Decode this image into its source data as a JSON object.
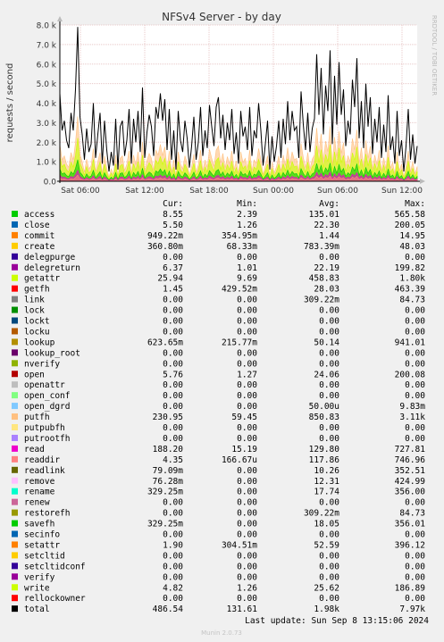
{
  "chart_data": {
    "type": "line",
    "title": "NFSv4 Server - by day",
    "ylabel": "requests / second",
    "side_label": "RRDTOOL / TOBI OETIKER",
    "ylim": [
      0,
      8000
    ],
    "yticks": [
      "0.0",
      "1.0 k",
      "2.0 k",
      "3.0 k",
      "4.0 k",
      "5.0 k",
      "6.0 k",
      "7.0 k",
      "8.0 k"
    ],
    "xticks": [
      "Sat 06:00",
      "Sat 12:00",
      "Sat 18:00",
      "Sun 00:00",
      "Sun 06:00",
      "Sun 12:00"
    ],
    "grid": true,
    "series": [
      {
        "name": "total",
        "color": "#000000",
        "values": [
          4500,
          2600,
          3100,
          2100,
          1700,
          3500,
          2600,
          4700,
          7900,
          3300,
          2400,
          1100,
          2700,
          1500,
          1900,
          4000,
          1200,
          2400,
          3500,
          900,
          3100,
          1600,
          500,
          1500,
          800,
          3200,
          600,
          2800,
          3100,
          1300,
          2100,
          3700,
          900,
          3200,
          2000,
          3600,
          1500,
          4800,
          1200,
          2500,
          3400,
          2800,
          1300,
          3800,
          3200,
          4500,
          3100,
          4200,
          1600,
          3700,
          1100,
          2600,
          600,
          3600,
          2100,
          1500,
          3100,
          2200,
          700,
          1800,
          3300,
          1100,
          2000,
          3800,
          1300,
          2600,
          1700,
          3900,
          2800,
          1800,
          3800,
          4300,
          2200,
          3400,
          1600,
          3000,
          2100,
          3700,
          1400,
          2500,
          900,
          3600,
          2300,
          2800,
          1600,
          3800,
          1300,
          2600,
          2200,
          4000,
          2600,
          800,
          1900,
          3100,
          600,
          2300,
          1000,
          1800,
          3100,
          1200,
          3200,
          1900,
          4100,
          2100,
          3600,
          2600,
          2800,
          1200,
          4600,
          2900,
          1600,
          3500,
          1500,
          2700,
          3200,
          6500,
          3400,
          5800,
          2400,
          4900,
          3600,
          6700,
          1900,
          5400,
          2900,
          6100,
          3400,
          4700,
          1800,
          3100,
          2400,
          5200,
          3800,
          6300,
          2200,
          4100,
          1700,
          5000,
          2800,
          4300,
          1400,
          3200,
          2000,
          3800,
          1200,
          2900,
          1500,
          4400,
          1600,
          2300,
          900,
          3600,
          1300,
          2100,
          500,
          1800,
          3700,
          1100,
          2400,
          900,
          1800
        ]
      }
    ]
  },
  "legend": {
    "headers": {
      "cur": "Cur:",
      "min": "Min:",
      "avg": "Avg:",
      "max": "Max:"
    },
    "rows": [
      {
        "name": "access",
        "color": "#00cc00",
        "cur": "8.55",
        "min": "2.39",
        "avg": "135.01",
        "max": "565.58"
      },
      {
        "name": "close",
        "color": "#0066b3",
        "cur": "5.50",
        "min": "1.26",
        "avg": "22.30",
        "max": "200.05"
      },
      {
        "name": "commit",
        "color": "#ff8000",
        "cur": "949.22m",
        "min": "354.95m",
        "avg": "1.44",
        "max": "14.95"
      },
      {
        "name": "create",
        "color": "#ffcc00",
        "cur": "360.80m",
        "min": "68.33m",
        "avg": "783.39m",
        "max": "48.03"
      },
      {
        "name": "delegpurge",
        "color": "#330099",
        "cur": "0.00",
        "min": "0.00",
        "avg": "0.00",
        "max": "0.00"
      },
      {
        "name": "delegreturn",
        "color": "#990099",
        "cur": "6.37",
        "min": "1.01",
        "avg": "22.19",
        "max": "199.82"
      },
      {
        "name": "getattr",
        "color": "#ccff00",
        "cur": "25.94",
        "min": "9.69",
        "avg": "458.83",
        "max": "1.80k"
      },
      {
        "name": "getfh",
        "color": "#ff0000",
        "cur": "1.45",
        "min": "429.52m",
        "avg": "28.03",
        "max": "463.39"
      },
      {
        "name": "link",
        "color": "#808080",
        "cur": "0.00",
        "min": "0.00",
        "avg": "309.22m",
        "max": "84.73"
      },
      {
        "name": "lock",
        "color": "#008f00",
        "cur": "0.00",
        "min": "0.00",
        "avg": "0.00",
        "max": "0.00"
      },
      {
        "name": "lockt",
        "color": "#00487d",
        "cur": "0.00",
        "min": "0.00",
        "avg": "0.00",
        "max": "0.00"
      },
      {
        "name": "locku",
        "color": "#b35a00",
        "cur": "0.00",
        "min": "0.00",
        "avg": "0.00",
        "max": "0.00"
      },
      {
        "name": "lookup",
        "color": "#b38f00",
        "cur": "623.65m",
        "min": "215.77m",
        "avg": "50.14",
        "max": "941.01"
      },
      {
        "name": "lookup_root",
        "color": "#6b006b",
        "cur": "0.00",
        "min": "0.00",
        "avg": "0.00",
        "max": "0.00"
      },
      {
        "name": "nverify",
        "color": "#8fb300",
        "cur": "0.00",
        "min": "0.00",
        "avg": "0.00",
        "max": "0.00"
      },
      {
        "name": "open",
        "color": "#b30000",
        "cur": "5.76",
        "min": "1.27",
        "avg": "24.06",
        "max": "200.08"
      },
      {
        "name": "openattr",
        "color": "#bebebe",
        "cur": "0.00",
        "min": "0.00",
        "avg": "0.00",
        "max": "0.00"
      },
      {
        "name": "open_conf",
        "color": "#80ff80",
        "cur": "0.00",
        "min": "0.00",
        "avg": "0.00",
        "max": "0.00"
      },
      {
        "name": "open_dgrd",
        "color": "#80c9ff",
        "cur": "0.00",
        "min": "0.00",
        "avg": "50.00u",
        "max": "9.83m"
      },
      {
        "name": "putfh",
        "color": "#ffc080",
        "cur": "230.95",
        "min": "59.45",
        "avg": "850.83",
        "max": "3.11k"
      },
      {
        "name": "putpubfh",
        "color": "#ffe680",
        "cur": "0.00",
        "min": "0.00",
        "avg": "0.00",
        "max": "0.00"
      },
      {
        "name": "putrootfh",
        "color": "#aa80ff",
        "cur": "0.00",
        "min": "0.00",
        "avg": "0.00",
        "max": "0.00"
      },
      {
        "name": "read",
        "color": "#ee00cc",
        "cur": "188.20",
        "min": "15.19",
        "avg": "129.80",
        "max": "727.81"
      },
      {
        "name": "readdir",
        "color": "#ff8080",
        "cur": "4.35",
        "min": "166.67u",
        "avg": "117.86",
        "max": "746.96"
      },
      {
        "name": "readlink",
        "color": "#666600",
        "cur": "79.09m",
        "min": "0.00",
        "avg": "10.26",
        "max": "352.51"
      },
      {
        "name": "remove",
        "color": "#ffbfff",
        "cur": "76.28m",
        "min": "0.00",
        "avg": "12.31",
        "max": "424.99"
      },
      {
        "name": "rename",
        "color": "#00ffcc",
        "cur": "329.25m",
        "min": "0.00",
        "avg": "17.74",
        "max": "356.00"
      },
      {
        "name": "renew",
        "color": "#cc6699",
        "cur": "0.00",
        "min": "0.00",
        "avg": "0.00",
        "max": "0.00"
      },
      {
        "name": "restorefh",
        "color": "#999900",
        "cur": "0.00",
        "min": "0.00",
        "avg": "309.22m",
        "max": "84.73"
      },
      {
        "name": "savefh",
        "color": "#00cc00",
        "cur": "329.25m",
        "min": "0.00",
        "avg": "18.05",
        "max": "356.01"
      },
      {
        "name": "secinfo",
        "color": "#0066b3",
        "cur": "0.00",
        "min": "0.00",
        "avg": "0.00",
        "max": "0.00"
      },
      {
        "name": "setattr",
        "color": "#ff8000",
        "cur": "1.90",
        "min": "304.51m",
        "avg": "52.59",
        "max": "396.12"
      },
      {
        "name": "setcltid",
        "color": "#ffcc00",
        "cur": "0.00",
        "min": "0.00",
        "avg": "0.00",
        "max": "0.00"
      },
      {
        "name": "setcltidconf",
        "color": "#330099",
        "cur": "0.00",
        "min": "0.00",
        "avg": "0.00",
        "max": "0.00"
      },
      {
        "name": "verify",
        "color": "#990099",
        "cur": "0.00",
        "min": "0.00",
        "avg": "0.00",
        "max": "0.00"
      },
      {
        "name": "write",
        "color": "#ccff00",
        "cur": "4.82",
        "min": "1.26",
        "avg": "25.62",
        "max": "186.89"
      },
      {
        "name": "rellockowner",
        "color": "#ff0000",
        "cur": "0.00",
        "min": "0.00",
        "avg": "0.00",
        "max": "0.00"
      },
      {
        "name": "total",
        "color": "#000000",
        "cur": "486.54",
        "min": "131.61",
        "avg": "1.98k",
        "max": "7.97k"
      }
    ]
  },
  "footer": {
    "last_update": "Last update: Sun Sep  8 13:15:06 2024",
    "munin_version": "Munin 2.0.73"
  }
}
